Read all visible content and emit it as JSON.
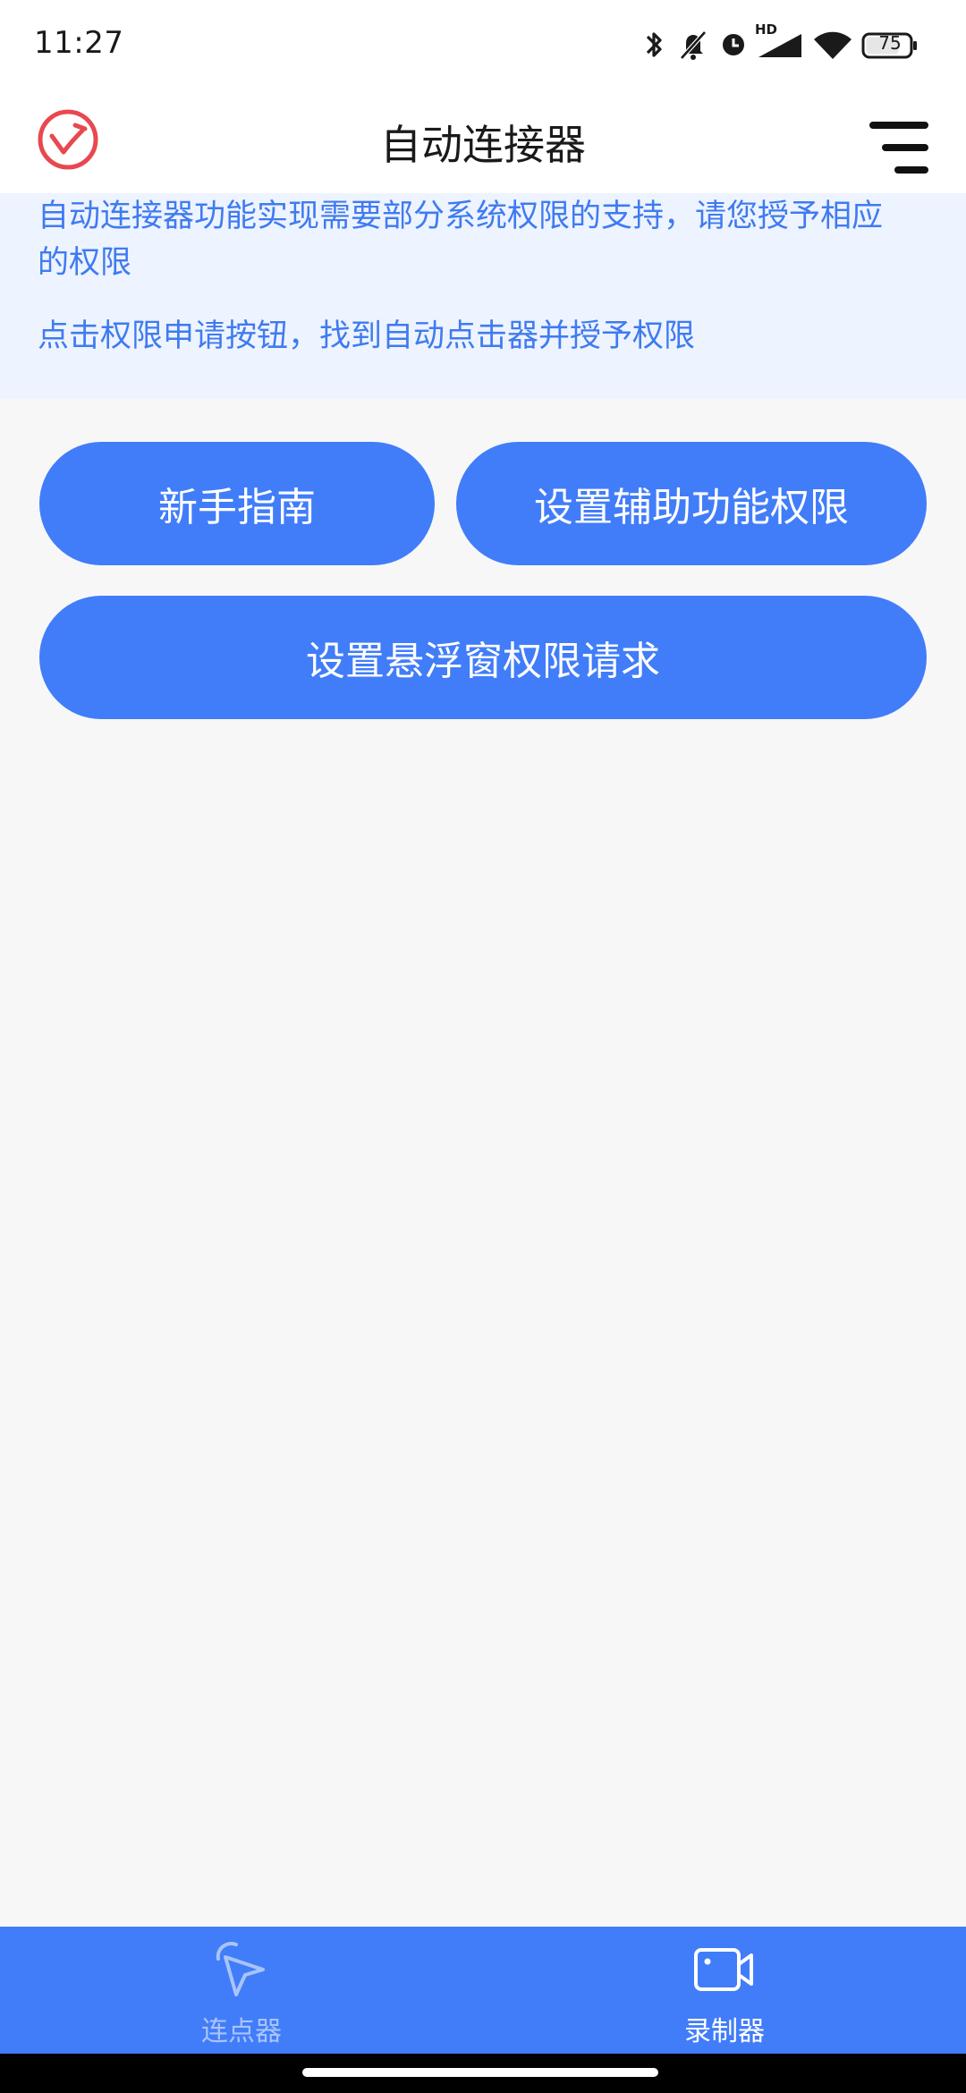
{
  "status_bar": {
    "time": "11:27",
    "network_badge": "HD",
    "battery_level": "75",
    "icons": [
      "bluetooth-icon",
      "mute-bell-icon",
      "alarm-icon",
      "signal-icon",
      "wifi-icon",
      "battery-icon"
    ]
  },
  "header": {
    "title": "自动连接器",
    "logo_icon": "app-logo-icon",
    "menu_icon": "menu-icon",
    "logo_color": "#e8484f"
  },
  "info": {
    "line1": "自动连接器功能实现需要部分系统权限的支持，请您授予相应的权限",
    "line2": "点击权限申请按钮，找到自动点击器并授予权限"
  },
  "buttons": {
    "guide": "新手指南",
    "accessibility": "设置辅助功能权限",
    "overlay": "设置悬浮窗权限请求"
  },
  "bottom_nav": {
    "items": [
      {
        "label": "连点器",
        "icon": "cursor-icon",
        "active": false
      },
      {
        "label": "录制器",
        "icon": "video-camera-icon",
        "active": true
      }
    ]
  },
  "colors": {
    "accent": "#417df9",
    "banner_bg": "#edf3ff",
    "banner_text": "#3f7bf0",
    "page_bg": "#f7f7f8"
  }
}
